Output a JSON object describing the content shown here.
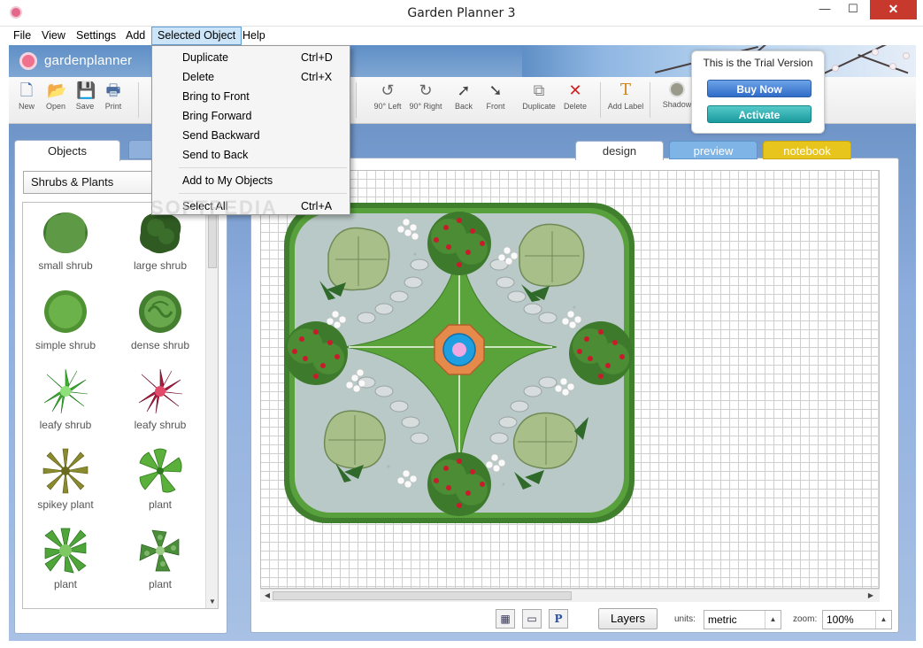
{
  "window": {
    "title": "Garden Planner 3",
    "min": "—",
    "max": "☐",
    "close": "✕"
  },
  "menubar": {
    "items": [
      "File",
      "View",
      "Settings",
      "Add",
      "Selected Object",
      "Help"
    ]
  },
  "brand": {
    "name": "gardenplanner"
  },
  "toolbar": {
    "new": "New",
    "open": "Open",
    "save": "Save",
    "print": "Print",
    "rotate_left": "90° Left",
    "rotate_right": "90° Right",
    "back": "Back",
    "front": "Front",
    "duplicate": "Duplicate",
    "delete": "Delete",
    "add_label": "Add Label",
    "shadow": "Shadow"
  },
  "trial": {
    "message": "This is the Trial Version",
    "buy": "Buy Now",
    "activate": "Activate"
  },
  "context_menu": {
    "items": [
      {
        "label": "Duplicate",
        "shortcut": "Ctrl+D"
      },
      {
        "label": "Delete",
        "shortcut": "Ctrl+X"
      },
      {
        "label": "Bring to Front",
        "shortcut": ""
      },
      {
        "label": "Bring Forward",
        "shortcut": ""
      },
      {
        "label": "Send Backward",
        "shortcut": ""
      },
      {
        "label": "Send to Back",
        "shortcut": ""
      },
      {
        "label": "Add to My Objects",
        "shortcut": ""
      },
      {
        "label": "Select All",
        "shortcut": "Ctrl+A"
      }
    ]
  },
  "left_panel": {
    "tab": "Objects",
    "category": "Shrubs & Plants",
    "plants": [
      {
        "label": "small shrub",
        "icon": "small-shrub-icon",
        "color": "#5e9a45"
      },
      {
        "label": "large shrub",
        "icon": "large-shrub-icon",
        "color": "#2f5a22"
      },
      {
        "label": "simple shrub",
        "icon": "simple-shrub-icon",
        "color": "#6cb24a"
      },
      {
        "label": "dense shrub",
        "icon": "dense-shrub-icon",
        "color": "#5a9e3c"
      },
      {
        "label": "leafy shrub",
        "icon": "leafy-shrub-green-icon",
        "color": "#3fae2f"
      },
      {
        "label": "leafy shrub",
        "icon": "leafy-shrub-red-icon",
        "color": "#b01a3e"
      },
      {
        "label": "spikey plant",
        "icon": "spikey-plant-icon",
        "color": "#8a8a2e"
      },
      {
        "label": "plant",
        "icon": "plant-star-icon",
        "color": "#5ab03a"
      },
      {
        "label": "plant",
        "icon": "plant-rosette-icon",
        "color": "#4fa43a"
      },
      {
        "label": "plant",
        "icon": "plant-fern-icon",
        "color": "#4a8e3a"
      }
    ]
  },
  "view_tabs": {
    "design": "design",
    "preview": "preview",
    "notebook": "notebook"
  },
  "bottom_bar": {
    "layers": "Layers",
    "units_label": "units:",
    "units_value": "metric",
    "zoom_label": "zoom:",
    "zoom_value": "100%",
    "p_icon": "P"
  },
  "watermark": "SOFTPEDIA",
  "colors": {
    "accent": "#7fb4e6",
    "notebook": "#e8c51c",
    "buy": "#2f6cc7",
    "activate": "#1a9a9d"
  }
}
